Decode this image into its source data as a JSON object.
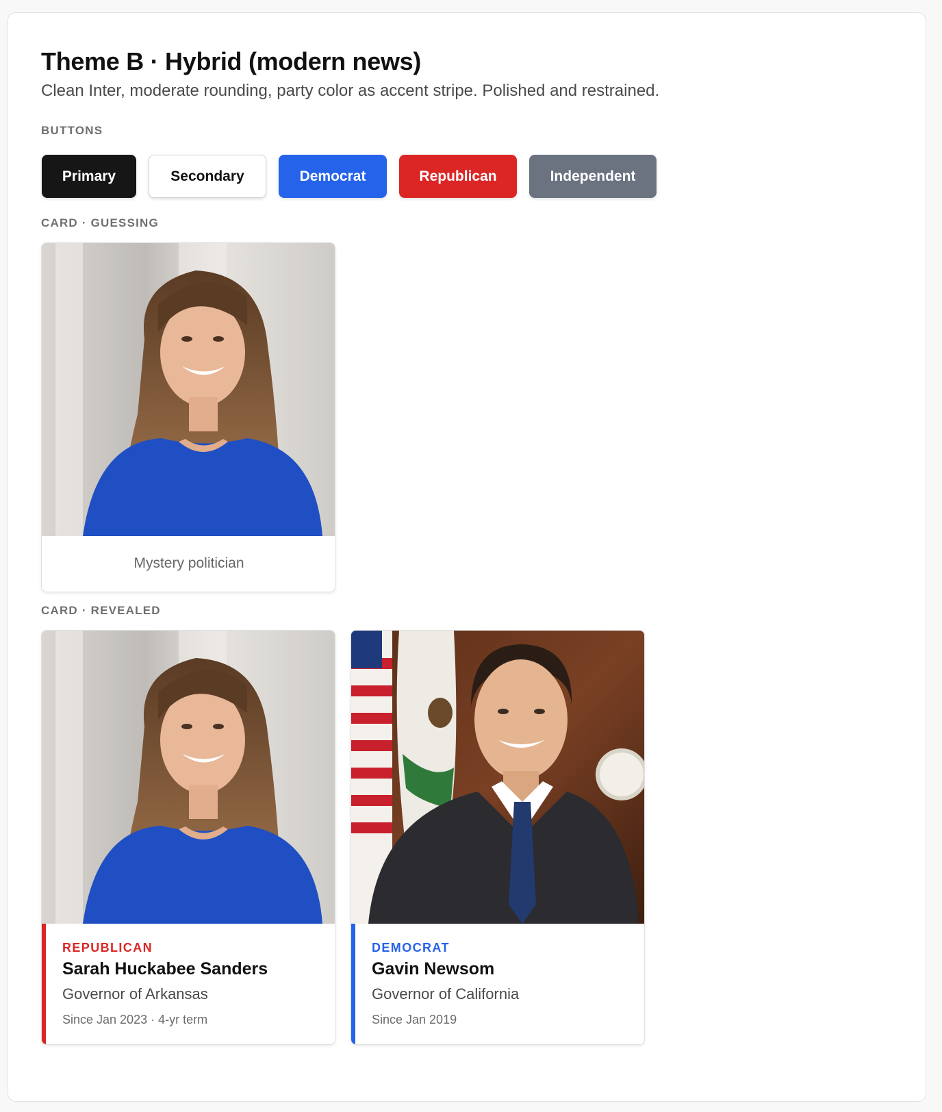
{
  "header": {
    "title": "Theme B · Hybrid (modern news)",
    "subtitle": "Clean Inter, moderate rounding, party color as accent stripe. Polished and restrained."
  },
  "sections": {
    "buttons_label": "BUTTONS",
    "guessing_label": "CARD · GUESSING",
    "revealed_label": "CARD · REVEALED"
  },
  "buttons": {
    "primary": "Primary",
    "secondary": "Secondary",
    "democrat": "Democrat",
    "republican": "Republican",
    "independent": "Independent"
  },
  "colors": {
    "primary": "#161616",
    "democrat": "#2563eb",
    "republican": "#dc2626",
    "independent": "#6b7280"
  },
  "guessing_card": {
    "caption": "Mystery politician",
    "photo": "portrait-woman-blue-top"
  },
  "revealed_cards": [
    {
      "party": "REPUBLICAN",
      "name": "Sarah Huckabee Sanders",
      "office": "Governor of Arkansas",
      "since": "Since Jan 2023 · 4-yr term",
      "photo": "portrait-woman-blue-top"
    },
    {
      "party": "DEMOCRAT",
      "name": "Gavin Newsom",
      "office": "Governor of California",
      "since": "Since Jan 2019",
      "photo": "portrait-man-dark-suit-flags"
    }
  ]
}
